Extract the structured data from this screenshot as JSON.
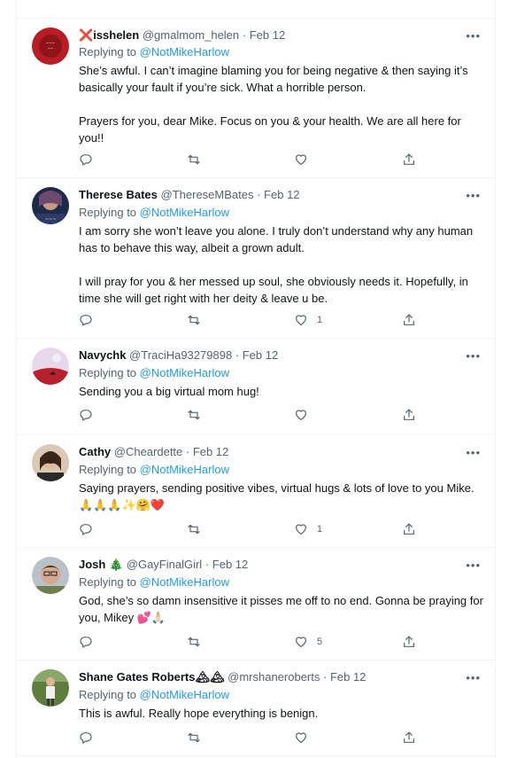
{
  "top_fragments": [
    "",
    "",
    ""
  ],
  "tweets": [
    {
      "name_prefix": "❌",
      "name": "isshelen",
      "handle": "@gmalmom_helen",
      "date": "· Feb 12",
      "replying_prefix": "Replying to ",
      "replying_to": "@NotMikeHarlow",
      "paragraphs": [
        "She’s awful. I can’t imagine blaming you for being negative & then saying it’s basically your fault if you’re sick. What a horrible person.",
        "Prayers for you, dear Mike. Focus on you & your health. We are all here for you!!"
      ],
      "likes": ""
    },
    {
      "name_prefix": "",
      "name": "Therese Bates",
      "handle": "@ThereseMBates",
      "date": "· Feb 12",
      "replying_prefix": "Replying to ",
      "replying_to": "@NotMikeHarlow",
      "paragraphs": [
        "I am sorry she won’t leave you alone. I truly don’t understand why any human has to behave this way, albeit a grown adult.",
        "I will pray for you & her messed up soul, she obviously needs it. Hopefully, in time she will get right with her deity & leave u be."
      ],
      "likes": "1"
    },
    {
      "name_prefix": "",
      "name": "Navychk",
      "handle": "@TraciHa93279898",
      "date": "· Feb 12",
      "replying_prefix": "Replying to ",
      "replying_to": "@NotMikeHarlow",
      "paragraphs": [
        "Sending you a big virtual mom hug!"
      ],
      "likes": ""
    },
    {
      "name_prefix": "",
      "name": "Cathy",
      "handle": "@Cheardette",
      "date": "· Feb 12",
      "replying_prefix": "Replying to ",
      "replying_to": "@NotMikeHarlow",
      "paragraphs": [
        "Saying prayers, sending positive vibes, virtual hugs & lots of love to you Mike. 🙏🙏🙏✨🤗❤️"
      ],
      "likes": "1"
    },
    {
      "name_prefix": "",
      "name": "Josh 🎄",
      "handle": "@GayFinalGirl",
      "date": "· Feb 12",
      "replying_prefix": "Replying to ",
      "replying_to": "@NotMikeHarlow",
      "paragraphs": [
        "God, she’s so damn insensitive it pisses me off to no end. Gonna be praying for you, Mikey 💕🙏🏻"
      ],
      "likes": "5"
    },
    {
      "name_prefix": "",
      "name": "Shane Gates Roberts🏔🏔",
      "handle": "@mrshaneroberts",
      "date": "· Feb 12",
      "replying_prefix": "Replying to ",
      "replying_to": "@NotMikeHarlow",
      "paragraphs": [
        "This is awful. Really hope everything is benign."
      ],
      "likes": ""
    }
  ],
  "colors": {
    "link": "#1d9bf0",
    "secondary": "#536471",
    "text": "#0f1419",
    "border": "#eff3f4"
  }
}
